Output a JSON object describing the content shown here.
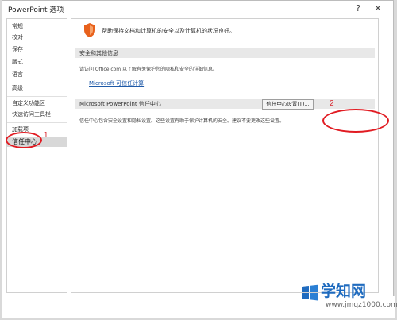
{
  "window": {
    "title": "PowerPoint 选项",
    "help_glyph": "?",
    "close_glyph": "✕"
  },
  "sidebar": {
    "items": [
      {
        "label": "常规"
      },
      {
        "label": "校对"
      },
      {
        "label": "保存"
      },
      {
        "label": "版式"
      },
      {
        "label": "语言"
      },
      {
        "label": "高级"
      },
      {
        "label": "自定义功能区"
      },
      {
        "label": "快速访问工具栏"
      },
      {
        "label": "加载项"
      },
      {
        "label": "信任中心",
        "active": true
      }
    ]
  },
  "main": {
    "intro": "帮助保持文档和计算机的安全以及计算机的状况良好。",
    "security_section": {
      "header": "安全和其他信息",
      "description": "请访问 Office.com 以了解有关保护您的隐私和安全的详细信息。",
      "link": "Microsoft 可信任计算"
    },
    "trust_section": {
      "header": "Microsoft PowerPoint 信任中心",
      "description": "信任中心包含安全设置和隐私设置。这些设置有助于保护计算机的安全。建议不要更改这些设置。",
      "button": "信任中心设置(T)..."
    }
  },
  "annotations": {
    "marker_1": "1",
    "marker_2": "2"
  },
  "watermark": {
    "brand": "学知网",
    "url": "www.jmqz1000.com"
  },
  "colors": {
    "accent_red": "#e11b22",
    "link_blue": "#1f5aa8",
    "shield_orange": "#e8611c"
  }
}
